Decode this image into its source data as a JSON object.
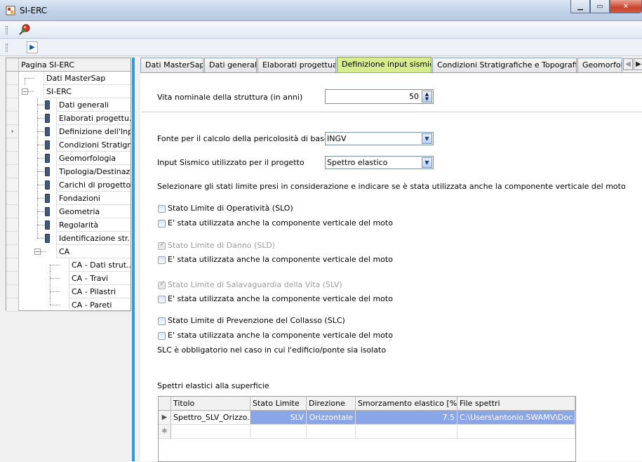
{
  "window": {
    "title": "SI-ERC"
  },
  "tree": {
    "header": "Pagina SI-ERC",
    "items": [
      {
        "label": "Dati MasterSap"
      },
      {
        "label": "SI-ERC"
      },
      {
        "label": "Dati generali"
      },
      {
        "label": "Elaborati progettu..."
      },
      {
        "label": "Definizione dell'Inp..."
      },
      {
        "label": "Condizioni Stratigr..."
      },
      {
        "label": "Geomorfologia"
      },
      {
        "label": "Tipologia/Destinazi..."
      },
      {
        "label": "Carichi di progetto..."
      },
      {
        "label": "Fondazioni"
      },
      {
        "label": "Geometria"
      },
      {
        "label": "Regolarità"
      },
      {
        "label": "Identificazione str..."
      },
      {
        "label": "CA"
      },
      {
        "label": "CA - Dati strut..."
      },
      {
        "label": "CA - Travi"
      },
      {
        "label": "CA - Pilastri"
      },
      {
        "label": "CA - Pareti"
      }
    ]
  },
  "tabs": [
    {
      "label": "Dati MasterSap"
    },
    {
      "label": "Dati generali"
    },
    {
      "label": "Elaborati progettuali"
    },
    {
      "label": "Definizione input sismico"
    },
    {
      "label": "Condizioni Stratigrafiche e Topografiche"
    },
    {
      "label": "Geomorfolo"
    }
  ],
  "form": {
    "vita_label": "Vita nominale della struttura (in anni)",
    "vita_value": "50",
    "fonte_label": "Fonte per il calcolo della pericolosità di base",
    "fonte_value": "INGV",
    "input_label": "Input Sismico utilizzato per il progetto",
    "input_value": "Spettro elastico",
    "instruction": "Selezionare gli stati limite presi in considerazione e indicare se è stata utilizzata anche la componente verticale del moto",
    "slo": "Stato Limite di Operatività (SLO)",
    "sld": "Stato Limite di Danno (SLD)",
    "slv": "Stato Limite di Salavaguardia della Vita (SLV)",
    "slc": "Stato Limite di Prevenzione del Collasso (SLC)",
    "vert": "E' stata utilizzata anche la componente verticale del moto",
    "slc_note": "SLC è obbligatorio nel caso in cui l'edificio/ponte sia isolato",
    "spettri_label": "Spettri elastici alla superficie"
  },
  "grid": {
    "columns": [
      "Titolo",
      "Stato Limite",
      "Direzione",
      "Smorzamento elastico [%]",
      "File spettri"
    ],
    "row": [
      "Spettro_SLV_Orizzo...",
      "SLV",
      "Orizzontale",
      "7.5",
      "C:\\Users\\antonio.SWAMV\\Doc..."
    ]
  },
  "icons": {
    "pin": "pin-icon",
    "nav": "arrow-right-icon"
  }
}
